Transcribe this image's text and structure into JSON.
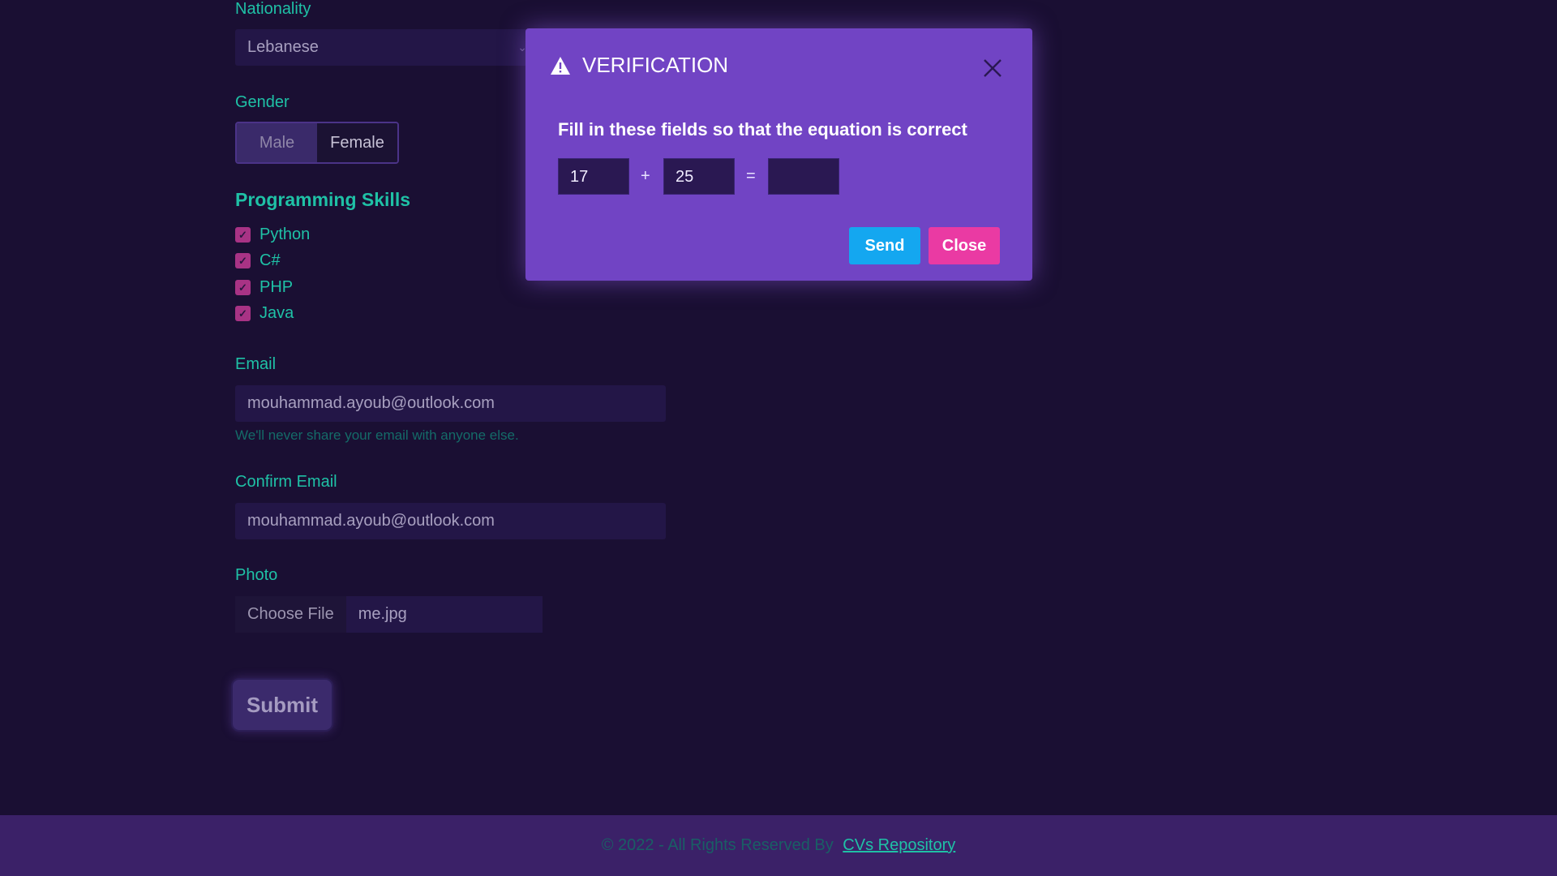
{
  "form": {
    "nationality": {
      "label": "Nationality",
      "value": "Lebanese"
    },
    "gender": {
      "label": "Gender",
      "options": [
        "Male",
        "Female"
      ],
      "selected": "Female"
    },
    "skills": {
      "title": "Programming Skills",
      "items": [
        {
          "label": "Python",
          "checked": true
        },
        {
          "label": "C#",
          "checked": true
        },
        {
          "label": "PHP",
          "checked": true
        },
        {
          "label": "Java",
          "checked": true
        }
      ]
    },
    "email": {
      "label": "Email",
      "value": "mouhammad.ayoub@outlook.com",
      "hint": "We'll never share your email with anyone else."
    },
    "confirm_email": {
      "label": "Confirm Email",
      "value": "mouhammad.ayoub@outlook.com"
    },
    "photo": {
      "label": "Photo",
      "button": "Choose File",
      "filename": "me.jpg"
    },
    "submit_label": "Submit"
  },
  "footer": {
    "copyright": "© 2022 - All Rights Reserved By",
    "link_text": "CVs Repository"
  },
  "modal": {
    "title": "VERIFICATION",
    "title_icon": "warning-icon",
    "close_icon": "close-icon",
    "prompt": "Fill in these fields so that the equation is correct",
    "operand1": "17",
    "plus": "+",
    "operand2": "25",
    "equals": "=",
    "answer": "",
    "send_label": "Send",
    "close_label": "Close"
  },
  "colors": {
    "background": "#1a0f33",
    "accent_teal": "#1fc1a6",
    "modal_bg": "#7144c4",
    "send_button": "#14a7f0",
    "close_button": "#ea3aa3",
    "footer_bg": "#3b2168"
  }
}
